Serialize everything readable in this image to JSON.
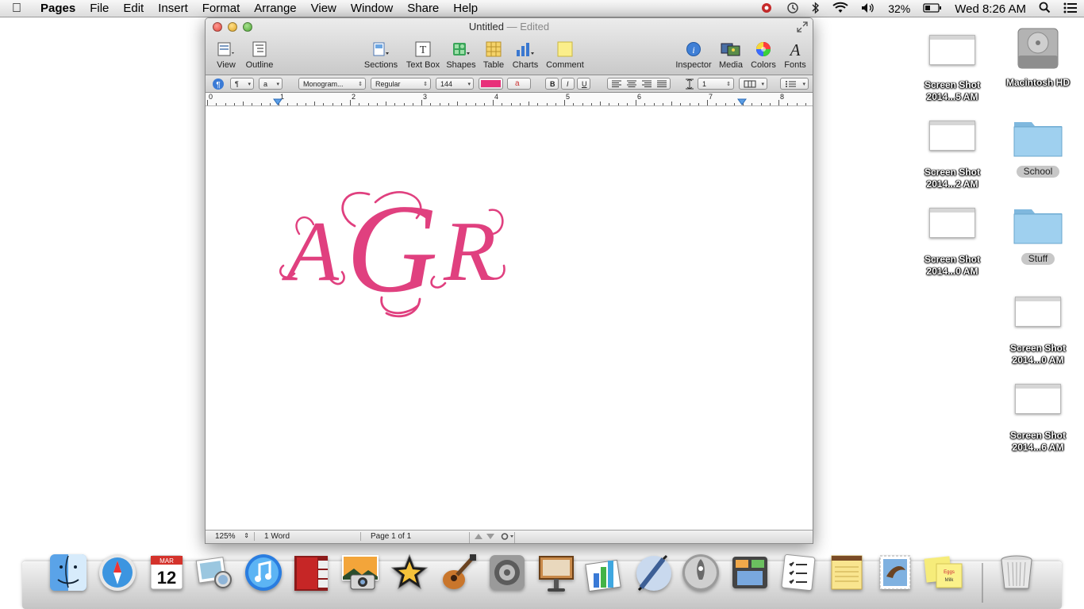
{
  "menubar": {
    "app_name": "Pages",
    "items": [
      "File",
      "Edit",
      "Insert",
      "Format",
      "Arrange",
      "View",
      "Window",
      "Share",
      "Help"
    ],
    "battery": "32%",
    "clock": "Wed 8:26 AM"
  },
  "window": {
    "title": "Untitled",
    "title_sep": " — ",
    "status": "Edited"
  },
  "toolbar": {
    "view": "View",
    "outline": "Outline",
    "sections": "Sections",
    "textbox": "Text Box",
    "shapes": "Shapes",
    "table": "Table",
    "charts": "Charts",
    "comment": "Comment",
    "inspector": "Inspector",
    "media": "Media",
    "colors": "Colors",
    "fonts": "Fonts"
  },
  "formatbar": {
    "paragraph_style": "¶",
    "character_style": "a",
    "font_family": "Monogram...",
    "font_style": "Regular",
    "font_size": "144",
    "text_color": "#e8307a",
    "bold": "B",
    "italic": "I",
    "underline": "U",
    "line_spacing": "1"
  },
  "ruler": {
    "numbers": [
      "0",
      "1",
      "2",
      "3",
      "4",
      "5",
      "6",
      "7",
      "8"
    ]
  },
  "document": {
    "monogram_letters": [
      "A",
      "G",
      "R"
    ],
    "monogram_color": "#e0407f"
  },
  "statusbar": {
    "zoom": "125%",
    "word_count": "1 Word",
    "page": "Page 1 of 1"
  },
  "desktop": {
    "icons": [
      {
        "label_line1": "Screen Shot",
        "label_line2": "2014...5 AM"
      },
      {
        "label_line1": "Macintosh HD"
      },
      {
        "label_line1": "Screen Shot",
        "label_line2": "2014...2 AM"
      },
      {
        "label_line1": "School"
      },
      {
        "label_line1": "Screen Shot",
        "label_line2": "2014...0 AM"
      },
      {
        "label_line1": "Stuff"
      },
      {
        "label_line1": "Screen Shot",
        "label_line2": "2014...0 AM"
      },
      {
        "label_line1": "Screen Shot",
        "label_line2": "2014...6 AM"
      }
    ]
  },
  "dock": {
    "calendar_month": "MAR",
    "calendar_day": "12",
    "apps": [
      "finder",
      "safari",
      "ical",
      "iphoto-booth",
      "itunes",
      "photo-booth",
      "iphoto",
      "imovie",
      "garageband",
      "system-preferences",
      "keynote",
      "numbers",
      "pages",
      "launchpad",
      "mission-control",
      "reminders",
      "notes",
      "mail",
      "stickies",
      "trash"
    ]
  }
}
